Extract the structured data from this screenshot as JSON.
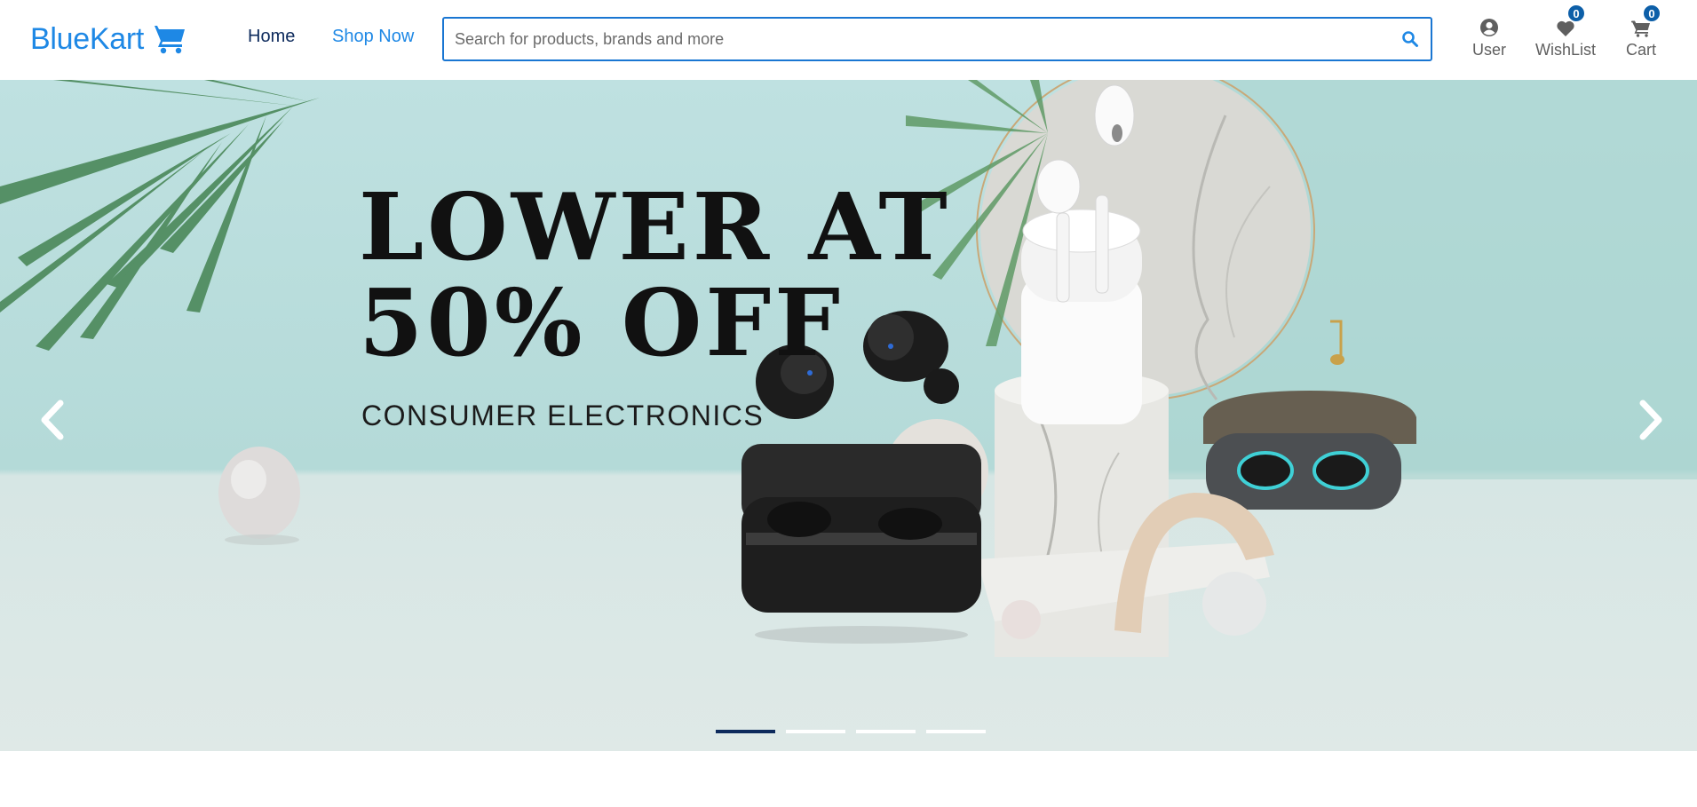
{
  "header": {
    "logo_text": "BlueKart",
    "nav": {
      "home": "Home",
      "shop_now": "Shop Now"
    },
    "search": {
      "placeholder": "Search for products, brands and more",
      "value": ""
    },
    "user_label": "User",
    "wishlist": {
      "label": "WishList",
      "count": "0"
    },
    "cart": {
      "label": "Cart",
      "count": "0"
    }
  },
  "banner": {
    "headline_line1": "LOWER AT",
    "headline_line2": "50% OFF",
    "subline": "CONSUMER ELECTRONICS",
    "slide_count": 4,
    "active_slide": 1
  },
  "colors": {
    "brand": "#1e88e5",
    "nav_dark": "#0d2a5c",
    "badge": "#0d5fa8",
    "banner_bg": "#bfe1e1"
  },
  "icons": [
    "shopping-cart-icon",
    "search-icon",
    "user-circle-icon",
    "heart-icon",
    "cart-icon",
    "chevron-left-icon",
    "chevron-right-icon"
  ]
}
